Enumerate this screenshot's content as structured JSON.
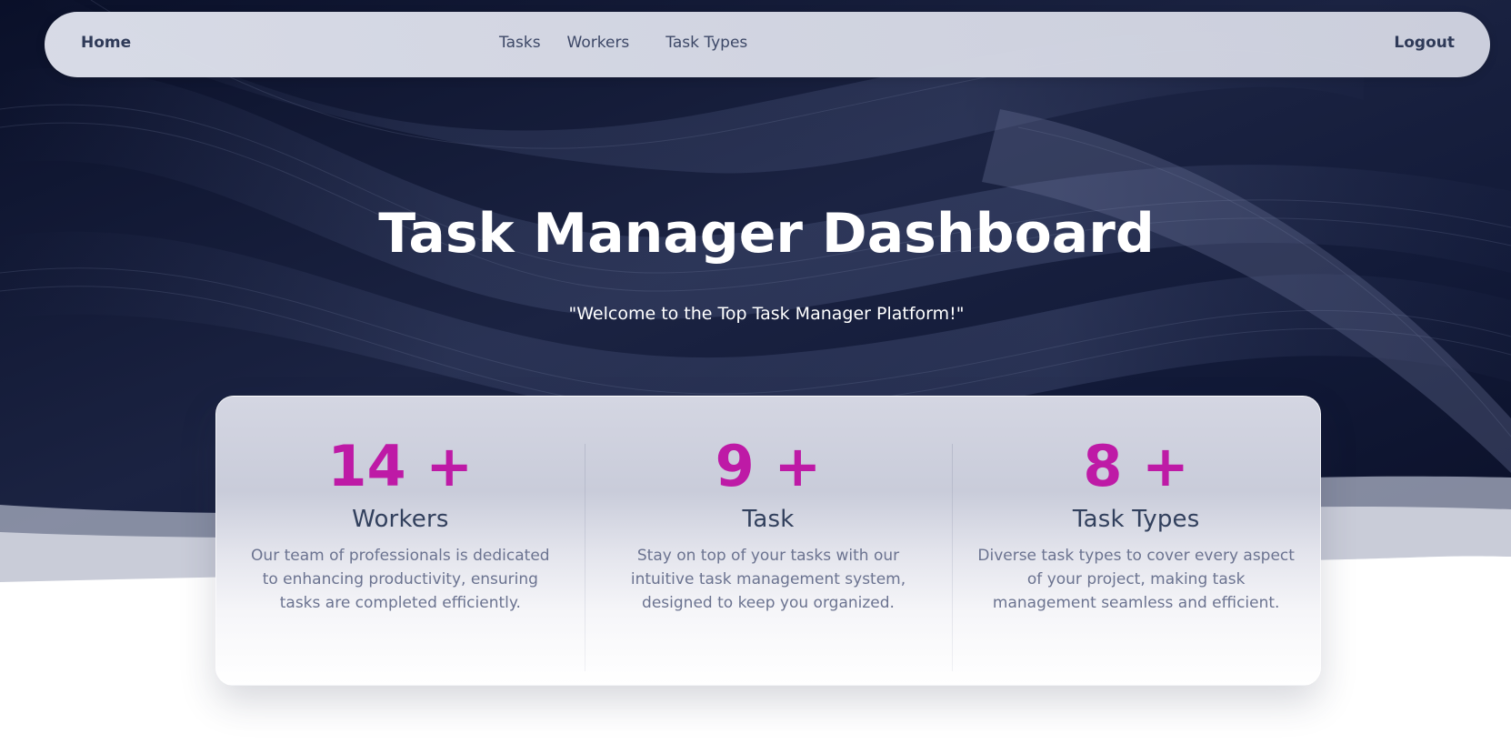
{
  "nav": {
    "home": "Home",
    "links": [
      "Tasks",
      "Workers",
      "Task Types"
    ],
    "logout": "Logout"
  },
  "hero": {
    "title": "Task Manager Dashboard",
    "subtitle": "\"Welcome to the Top Task Manager Platform!\""
  },
  "stats": [
    {
      "number": "14 +",
      "label": "Workers",
      "description": "Our team of professionals is dedicated to enhancing productivity, ensuring tasks are completed efficiently."
    },
    {
      "number": "9 +",
      "label": "Task",
      "description": "Stay on top of your tasks with our intuitive task management system, designed to keep you organized."
    },
    {
      "number": "8 +",
      "label": "Task Types",
      "description": "Diverse task types to cover every aspect of your project, making task management seamless and efficient."
    }
  ],
  "colors": {
    "accent": "#be1aa6",
    "hero_background": "#0b1230",
    "nav_text": "#2f3a58"
  }
}
